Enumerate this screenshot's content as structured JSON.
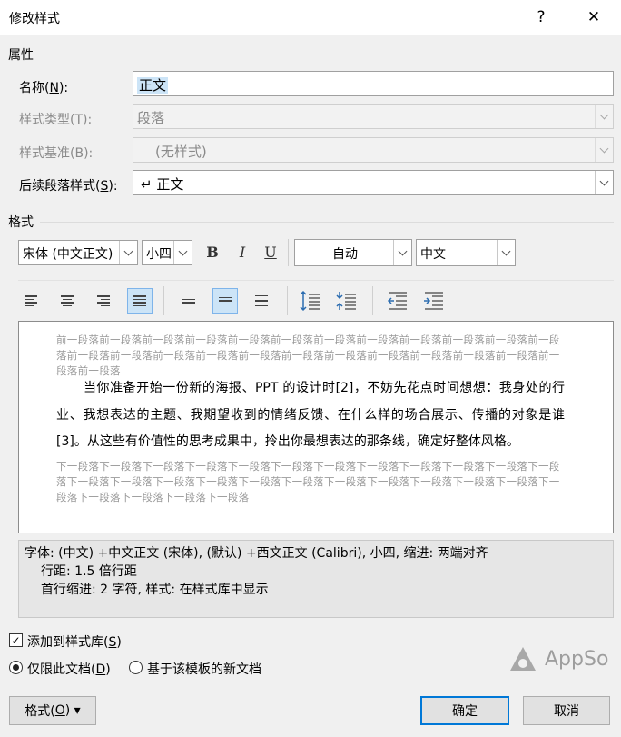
{
  "window": {
    "title": "修改样式",
    "help_label": "?",
    "close_label": "✕"
  },
  "properties": {
    "section_label": "属性",
    "name_label": "名称(N):",
    "name_value": "正文",
    "style_type_label": "样式类型(T):",
    "style_type_value": "段落",
    "style_based_label": "样式基准(B):",
    "style_based_value": "(无样式)",
    "following_label": "后续段落样式(S):",
    "following_value": "↵ 正文"
  },
  "format": {
    "section_label": "格式",
    "font_name": "宋体 (中文正文)",
    "font_size": "小四",
    "bold_label": "B",
    "italic_label": "I",
    "underline_label": "U",
    "color_value": "自动",
    "language_value": "中文"
  },
  "preview": {
    "prev_paragraph": "前一段落前一段落前一段落前一段落前一段落前一段落前一段落前一段落前一段落前一段落前一段落前一段落前一段落前一段落前一段落前一段落前一段落前一段落前一段落前一段落前一段落前一段落前一段落前一段落前一段落",
    "sample_text": "当你准备开始一份新的海报、PPT 的设计时[2]，不妨先花点时间想想：我身处的行业、我想表达的主题、我期望收到的情绪反馈、在什么样的场合展示、传播的对象是谁[3]。从这些有价值性的思考成果中，拎出你最想表达的那条线，确定好整体风格。",
    "next_paragraph": "下一段落下一段落下一段落下一段落下一段落下一段落下一段落下一段落下一段落下一段落下一段落下一段落下一段落下一段落下一段落下一段落下一段落下一段落下一段落下一段落下一段落下一段落下一段落下一段落下一段落下一段落下一段落下一段落"
  },
  "description": {
    "line1": "字体: (中文) +中文正文 (宋体), (默认) +西文正文 (Calibri), 小四, 缩进: 两端对齐",
    "line2": "行距: 1.5 倍行距",
    "line3": "首行缩进:  2 字符, 样式: 在样式库中显示"
  },
  "options": {
    "add_to_gallery_label": "添加到样式库(S)",
    "add_to_gallery_checked": true,
    "only_this_doc_label": "仅限此文档(D)",
    "new_docs_label": "基于该模板的新文档",
    "selected_scope": "only_this_doc"
  },
  "buttons": {
    "format_label": "格式(O) ▾",
    "ok_label": "确定",
    "cancel_label": "取消"
  },
  "watermark": {
    "text": "AppSo"
  }
}
